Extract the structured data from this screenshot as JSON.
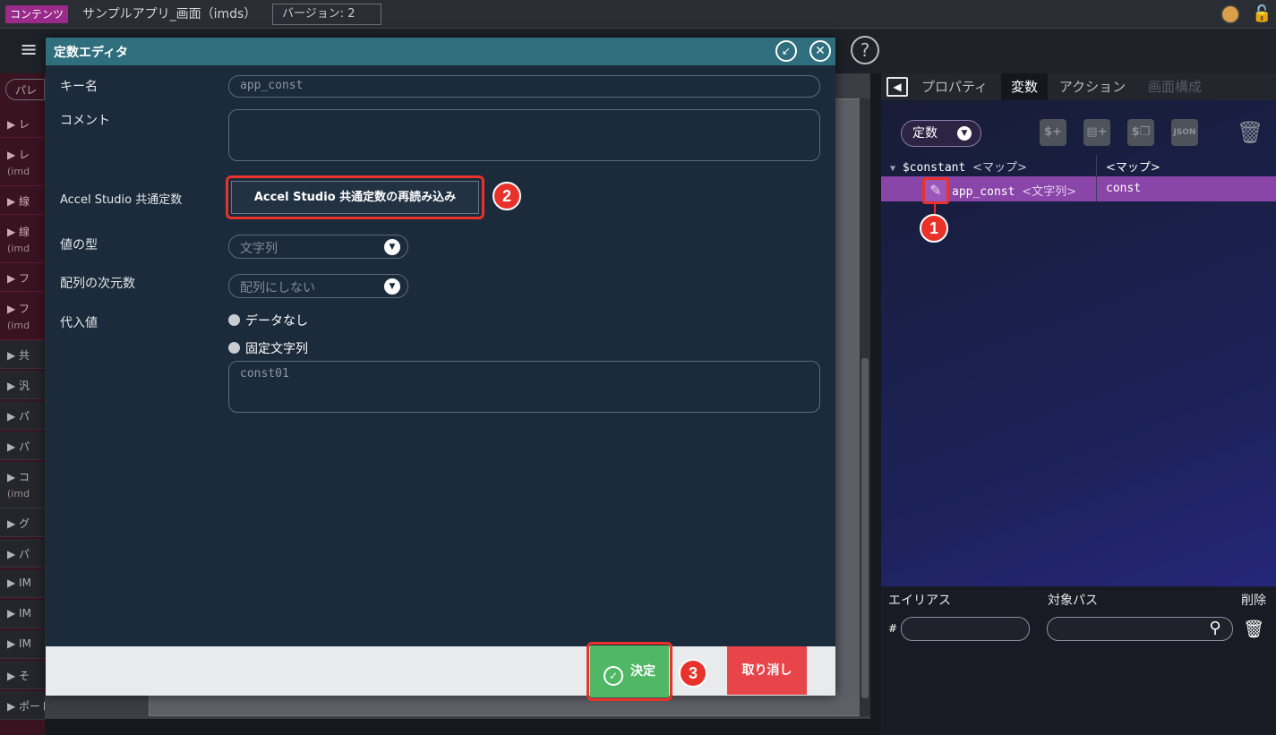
{
  "topbar": {
    "content_badge": "コンテンツ",
    "app_title": "サンプルアプリ_画面（imds）",
    "version": "バージョン: 2"
  },
  "palette": {
    "search_placeholder": "パレ",
    "items": [
      {
        "label": "レ"
      },
      {
        "label": "レ",
        "sub": "(imd"
      },
      {
        "label": "線"
      },
      {
        "label": "線",
        "sub": "(imd"
      },
      {
        "label": "フ"
      },
      {
        "label": "フ",
        "sub": "(imd"
      },
      {
        "label": "共"
      },
      {
        "label": "汎"
      },
      {
        "label": "パ"
      },
      {
        "label": "パ"
      },
      {
        "label": "コ",
        "sub": "(imd"
      },
      {
        "label": "グ"
      },
      {
        "label": "パ"
      },
      {
        "label": "IM"
      },
      {
        "label": "IM"
      },
      {
        "label": "IM"
      },
      {
        "label": "そ"
      },
      {
        "label": "ポートレット"
      }
    ]
  },
  "right_panel": {
    "tabs": [
      "プロパティ",
      "変数",
      "アクション",
      "画面構成"
    ],
    "active_tab": "変数",
    "dropdown_label": "定数",
    "tree": {
      "root_name": "$constant",
      "root_type": "<マップ>",
      "root_value_type": "<マップ>",
      "row_key": "app_const",
      "row_type": "<文字列>",
      "row_value": "const"
    },
    "alias": {
      "alias_label": "エイリアス",
      "path_label": "対象パス",
      "delete_label": "削除",
      "hash": "#"
    }
  },
  "modal": {
    "title": "定数エディタ",
    "key_label": "キー名",
    "key_value": "app_const",
    "comment_label": "コメント",
    "common_label": "Accel Studio 共通定数",
    "reload_button": "Accel Studio 共通定数の再読み込み",
    "type_label": "値の型",
    "type_value": "文字列",
    "dims_label": "配列の次元数",
    "dims_value": "配列にしない",
    "assign_label": "代入値",
    "radio_none": "データなし",
    "radio_fixed": "固定文字列",
    "fixed_value": "const01",
    "ok_button": "決定",
    "cancel_button": "取り消し"
  },
  "steps": [
    "1",
    "2",
    "3"
  ],
  "colors": {
    "accent_red": "#e8322a",
    "modal_header": "#2f6f7d",
    "ok_green": "#4fb765",
    "cancel_red": "#e8454a",
    "selected_row": "#8a45a8"
  }
}
